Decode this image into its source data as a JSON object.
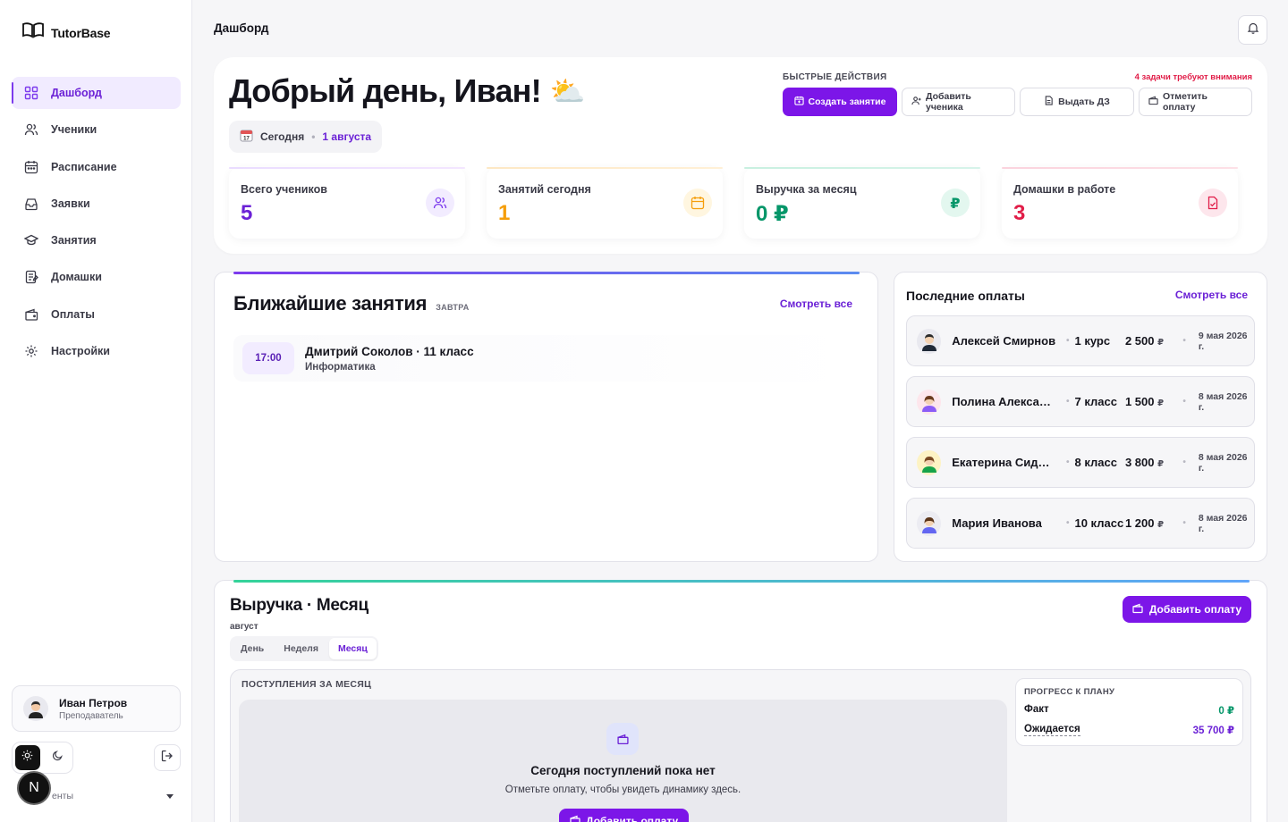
{
  "app": {
    "name": "TutorBase"
  },
  "sidebar": {
    "items": [
      {
        "label": "Дашборд",
        "icon": "grid-icon",
        "active": true
      },
      {
        "label": "Ученики",
        "icon": "users-icon"
      },
      {
        "label": "Расписание",
        "icon": "calendar-icon"
      },
      {
        "label": "Заявки",
        "icon": "inbox-icon"
      },
      {
        "label": "Занятия",
        "icon": "graduation-cap-icon"
      },
      {
        "label": "Домашки",
        "icon": "notebook-icon"
      },
      {
        "label": "Оплаты",
        "icon": "wallet-icon"
      },
      {
        "label": "Настройки",
        "icon": "gear-icon"
      }
    ],
    "user": {
      "name": "Иван Петров",
      "role": "Преподаватель"
    },
    "footer_select": "енты"
  },
  "header": {
    "title": "Дашборд"
  },
  "hero": {
    "greeting": "Добрый день, Иван!",
    "emoji": "⛅",
    "date_label": "Сегодня",
    "date_value": "1 августа",
    "quick_actions_label": "БЫСТРЫЕ ДЕЙСТВИЯ",
    "attention": "4 задачи требуют внимания",
    "actions": {
      "create_lesson": "Создать занятие",
      "add_student": "Добавить ученика",
      "assign_hw": "Выдать ДЗ",
      "mark_payment": "Отметить оплату"
    },
    "stats": [
      {
        "label": "Всего учеников",
        "value": "5",
        "color": "#6b21d6"
      },
      {
        "label": "Занятий сегодня",
        "value": "1",
        "color": "#f59e0b"
      },
      {
        "label": "Выручка за месяц",
        "value": "0 ₽",
        "color": "#059669"
      },
      {
        "label": "Домашки в работе",
        "value": "3",
        "color": "#e11d48"
      }
    ]
  },
  "upcoming": {
    "title": "Ближайшие занятия",
    "subtitle": "ЗАВТРА",
    "see_all": "Смотреть все",
    "lessons": [
      {
        "time": "17:00",
        "name": "Дмитрий Соколов · 11 класс",
        "subject": "Информатика"
      }
    ]
  },
  "payments": {
    "title": "Последние оплаты",
    "see_all": "Смотреть все",
    "rows": [
      {
        "name": "Алексей Смирнов",
        "course": "1 курс",
        "amount": "2 500",
        "currency": "₽",
        "date": "9 мая 2026 г."
      },
      {
        "name": "Полина Алекса…",
        "course": "7 класс",
        "amount": "1 500",
        "currency": "₽",
        "date": "8 мая 2026 г."
      },
      {
        "name": "Екатерина Сид…",
        "course": "8 класс",
        "amount": "3 800",
        "currency": "₽",
        "date": "8 мая 2026 г."
      },
      {
        "name": "Мария Иванова",
        "course": "10 класс",
        "amount": "1 200",
        "currency": "₽",
        "date": "8 мая 2026 г."
      }
    ]
  },
  "revenue": {
    "title": "Выручка · Месяц",
    "subtitle": "август",
    "tabs": [
      "День",
      "Неделя",
      "Месяц"
    ],
    "active_tab": "Месяц",
    "add_payment": "Добавить оплату",
    "income_label": "ПОСТУПЛЕНИЯ ЗА МЕСЯЦ",
    "empty_title": "Сегодня поступлений пока нет",
    "empty_text": "Отметьте оплату, чтобы увидеть динамику здесь.",
    "empty_button": "Добавить оплату",
    "plan": {
      "label": "ПРОГРЕСС К ПЛАНУ",
      "fact_label": "Факт",
      "fact_value": "0 ₽",
      "expected_label": "Ожидается",
      "expected_value": "35 700 ₽"
    }
  },
  "misc": {
    "badge": "N"
  }
}
